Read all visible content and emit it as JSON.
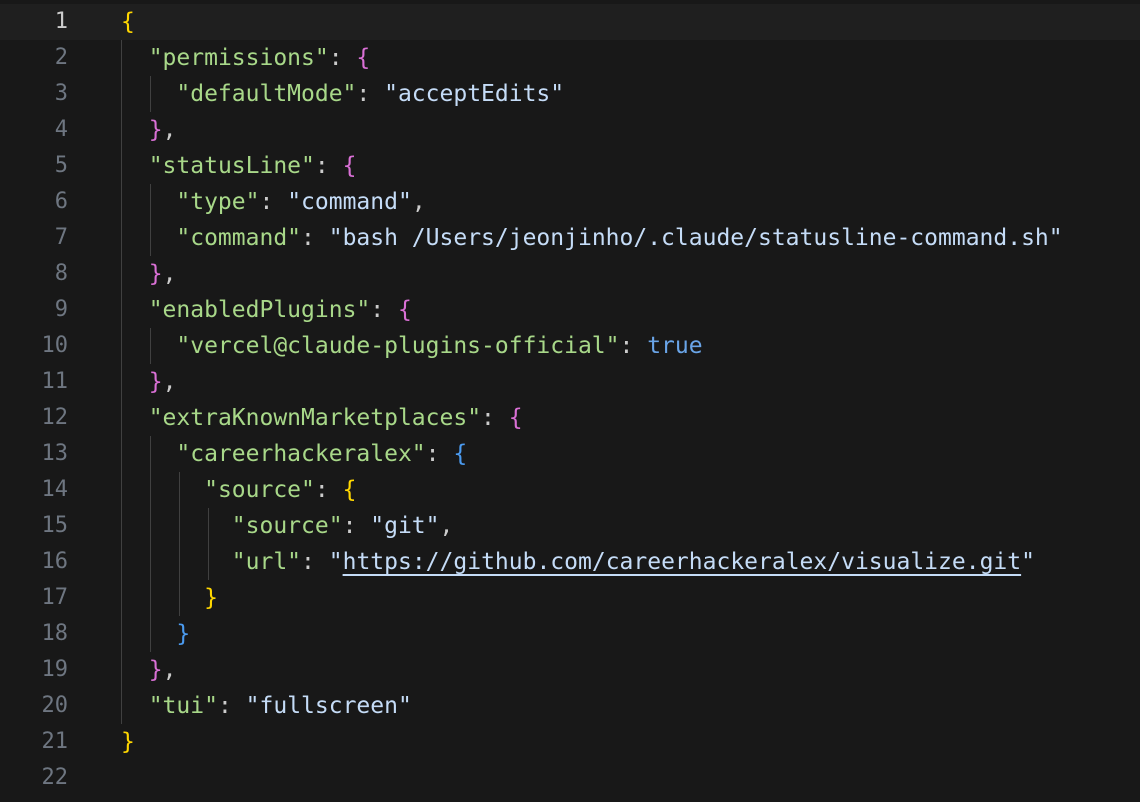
{
  "editor": {
    "current_line": 1,
    "lines": [
      {
        "num": "1",
        "tokens": [
          {
            "t": "{",
            "c": "b1"
          }
        ]
      },
      {
        "num": "2",
        "tokens": [
          {
            "t": "  "
          },
          {
            "t": "\"permissions\"",
            "c": "key"
          },
          {
            "t": ": "
          },
          {
            "t": "{",
            "c": "b2"
          }
        ]
      },
      {
        "num": "3",
        "tokens": [
          {
            "t": "    "
          },
          {
            "t": "\"defaultMode\"",
            "c": "key"
          },
          {
            "t": ": "
          },
          {
            "t": "\"acceptEdits\"",
            "c": "str"
          }
        ]
      },
      {
        "num": "4",
        "tokens": [
          {
            "t": "  "
          },
          {
            "t": "}",
            "c": "b2"
          },
          {
            "t": ","
          }
        ]
      },
      {
        "num": "5",
        "tokens": [
          {
            "t": "  "
          },
          {
            "t": "\"statusLine\"",
            "c": "key"
          },
          {
            "t": ": "
          },
          {
            "t": "{",
            "c": "b2"
          }
        ]
      },
      {
        "num": "6",
        "tokens": [
          {
            "t": "    "
          },
          {
            "t": "\"type\"",
            "c": "key"
          },
          {
            "t": ": "
          },
          {
            "t": "\"command\"",
            "c": "str"
          },
          {
            "t": ","
          }
        ]
      },
      {
        "num": "7",
        "tokens": [
          {
            "t": "    "
          },
          {
            "t": "\"command\"",
            "c": "key"
          },
          {
            "t": ": "
          },
          {
            "t": "\"bash /Users/jeonjinho/.claude/statusline-command.sh\"",
            "c": "str"
          }
        ]
      },
      {
        "num": "8",
        "tokens": [
          {
            "t": "  "
          },
          {
            "t": "}",
            "c": "b2"
          },
          {
            "t": ","
          }
        ]
      },
      {
        "num": "9",
        "tokens": [
          {
            "t": "  "
          },
          {
            "t": "\"enabledPlugins\"",
            "c": "key"
          },
          {
            "t": ": "
          },
          {
            "t": "{",
            "c": "b2"
          }
        ]
      },
      {
        "num": "10",
        "tokens": [
          {
            "t": "    "
          },
          {
            "t": "\"vercel@claude-plugins-official\"",
            "c": "key"
          },
          {
            "t": ": "
          },
          {
            "t": "true",
            "c": "kw"
          }
        ]
      },
      {
        "num": "11",
        "tokens": [
          {
            "t": "  "
          },
          {
            "t": "}",
            "c": "b2"
          },
          {
            "t": ","
          }
        ]
      },
      {
        "num": "12",
        "tokens": [
          {
            "t": "  "
          },
          {
            "t": "\"extraKnownMarketplaces\"",
            "c": "key"
          },
          {
            "t": ": "
          },
          {
            "t": "{",
            "c": "b2"
          }
        ]
      },
      {
        "num": "13",
        "tokens": [
          {
            "t": "    "
          },
          {
            "t": "\"careerhackeralex\"",
            "c": "key"
          },
          {
            "t": ": "
          },
          {
            "t": "{",
            "c": "b3"
          }
        ]
      },
      {
        "num": "14",
        "tokens": [
          {
            "t": "      "
          },
          {
            "t": "\"source\"",
            "c": "key"
          },
          {
            "t": ": "
          },
          {
            "t": "{",
            "c": "b1"
          }
        ]
      },
      {
        "num": "15",
        "tokens": [
          {
            "t": "        "
          },
          {
            "t": "\"source\"",
            "c": "key"
          },
          {
            "t": ": "
          },
          {
            "t": "\"git\"",
            "c": "str"
          },
          {
            "t": ","
          }
        ]
      },
      {
        "num": "16",
        "tokens": [
          {
            "t": "        "
          },
          {
            "t": "\"url\"",
            "c": "key"
          },
          {
            "t": ": "
          },
          {
            "t": "\"",
            "c": "str"
          },
          {
            "t": "https://github.com/careerhackeralex/visualize.git",
            "c": "link"
          },
          {
            "t": "\"",
            "c": "str"
          }
        ]
      },
      {
        "num": "17",
        "tokens": [
          {
            "t": "      "
          },
          {
            "t": "}",
            "c": "b1"
          }
        ]
      },
      {
        "num": "18",
        "tokens": [
          {
            "t": "    "
          },
          {
            "t": "}",
            "c": "b3"
          }
        ]
      },
      {
        "num": "19",
        "tokens": [
          {
            "t": "  "
          },
          {
            "t": "}",
            "c": "b2"
          },
          {
            "t": ","
          }
        ]
      },
      {
        "num": "20",
        "tokens": [
          {
            "t": "  "
          },
          {
            "t": "\"tui\"",
            "c": "key"
          },
          {
            "t": ": "
          },
          {
            "t": "\"fullscreen\"",
            "c": "str"
          }
        ]
      },
      {
        "num": "21",
        "tokens": [
          {
            "t": "}",
            "c": "b1"
          }
        ]
      },
      {
        "num": "22",
        "tokens": []
      }
    ]
  },
  "colors": {
    "background": "#181818",
    "current_line": "#1f1f1f",
    "key": "#9cdcfe",
    "string": "#ce9178",
    "bracket_gold": "#ffd700",
    "bracket_magenta": "#da70d6",
    "bracket_blue": "#179fff",
    "keyword": "#569cd6"
  }
}
